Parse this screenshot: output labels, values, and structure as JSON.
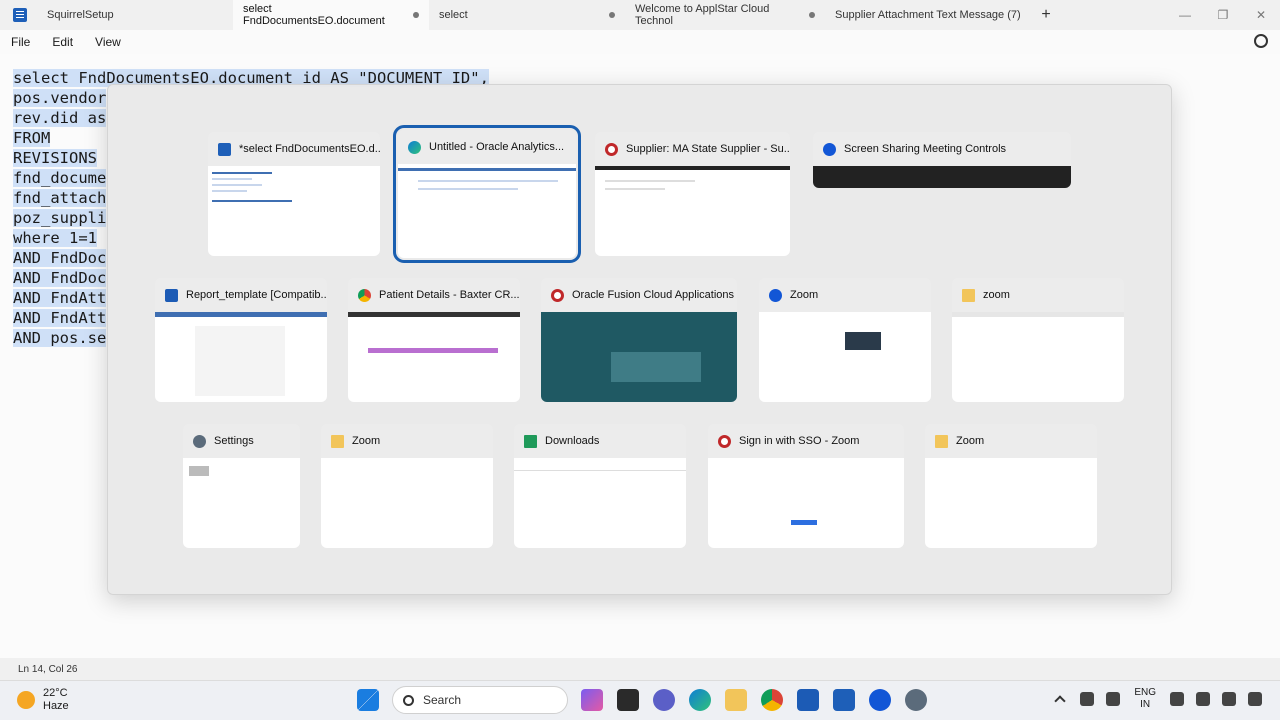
{
  "tabs": [
    {
      "label": "SquirrelSetup"
    },
    {
      "label": "select FndDocumentsEO.document"
    },
    {
      "label": "select"
    },
    {
      "label": "Welcome to ApplStar Cloud Technol"
    },
    {
      "label": "Supplier Attachment Text Message (7)"
    }
  ],
  "menu": [
    "File",
    "Edit",
    "View"
  ],
  "code": [
    "select FndDocumentsEO.document id AS \"DOCUMENT ID\",",
    "pos.vendor",
    "rev.did as",
    "FROM",
    "REVISIONS",
    "fnd_docume",
    "fnd_attach",
    "poz_suppli",
    "where 1=1",
    "AND FndDoc",
    "AND FndDoc",
    "AND FndAtt",
    "AND FndAtt",
    "AND pos.se"
  ],
  "status": {
    "position": "Ln 14, Col 26"
  },
  "windows": [
    {
      "title": "*select FndDocumentsEO.d...",
      "icon": "notepad-icon"
    },
    {
      "title": "Untitled - Oracle Analytics...",
      "icon": "edge-icon"
    },
    {
      "title": "Supplier: MA State Supplier - Su...",
      "icon": "oracle-icon"
    },
    {
      "title": "Screen Sharing Meeting Controls",
      "icon": "zoom-icon"
    },
    {
      "title": "Report_template [Compatib...",
      "icon": "word-icon"
    },
    {
      "title": "Patient Details - Baxter CR...",
      "icon": "chrome-icon"
    },
    {
      "title": "Oracle Fusion Cloud Applications",
      "icon": "oracle-icon"
    },
    {
      "title": "Zoom",
      "icon": "zoom-icon"
    },
    {
      "title": "zoom",
      "icon": "folder-icon"
    },
    {
      "title": "Settings",
      "icon": "settings-icon"
    },
    {
      "title": "Zoom",
      "icon": "folder-icon"
    },
    {
      "title": "Downloads",
      "icon": "downloads-icon"
    },
    {
      "title": "Sign in with SSO - Zoom",
      "icon": "oracle-icon"
    },
    {
      "title": "Zoom",
      "icon": "folder-icon"
    }
  ],
  "taskbar": {
    "weather_temp": "22°C",
    "weather_desc": "Haze",
    "search_label": "Search",
    "lang_line1": "ENG",
    "lang_line2": "IN"
  }
}
